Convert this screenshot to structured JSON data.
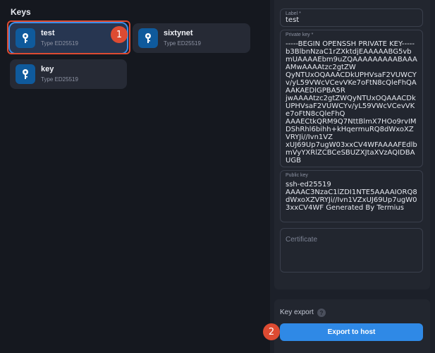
{
  "keys_section": {
    "title": "Keys"
  },
  "keys": [
    {
      "name": "test",
      "type": "Type ED25519"
    },
    {
      "name": "sixtynet",
      "type": "Type ED25519"
    },
    {
      "name": "key",
      "type": "Type ED25519"
    }
  ],
  "annotations": {
    "step1": "1",
    "step2": "2"
  },
  "editor": {
    "label_field": {
      "label": "Label *",
      "value": "test"
    },
    "private_key_field": {
      "label": "Private key *",
      "value": "-----BEGIN OPENSSH PRIVATE KEY-----\nb3BlbnNzaC1rZXktdjEAAAAABG5vbmUAAAAEbm9uZQAAAAAAAAABAAAAMwAAAAtzc2gtZW\nQyNTUxOQAAACDkUPHVsaF2VUWCYv/yL59VWcVCevVKe7oFtN8cQleFhQAAAKAEDlGPBA5R\njwAAAAtzc2gtZWQyNTUxOQAAACDkUPHVsaF2VUWCYv/yL59VWcVCevVKe7oFtN8cQleFhQ\nAAAECtkQRM9Q7NttBlmX7HOo9rvIMDShRhl6bihh+kHqermuRQ8dWxoXZVRYJi//Ivn1VZ\nxUJ69Up7ugW03xxCV4WFAAAAFEdlbmVyYXRlZCBCeSBUZXJtaXVzAQIDBAUGB"
    },
    "public_key_field": {
      "label": "Public key",
      "value": "ssh-ed25519\nAAAAC3NzaC1lZDI1NTE5AAAAIORQ8dWxoXZVRYJi//Ivn1VZxUJ69Up7ugW03xxCV4WF Generated By Termius"
    },
    "certificate_field": {
      "placeholder": "Certificate"
    }
  },
  "key_export": {
    "title": "Key export",
    "help_icon": "?",
    "button_label": "Export to host"
  },
  "colors": {
    "accent": "#2f89e6",
    "annotation": "#dd4b32",
    "key_icon_bg": "#0f5a9c"
  },
  "icons": {
    "key": "key-icon",
    "help": "question-circle-icon"
  }
}
